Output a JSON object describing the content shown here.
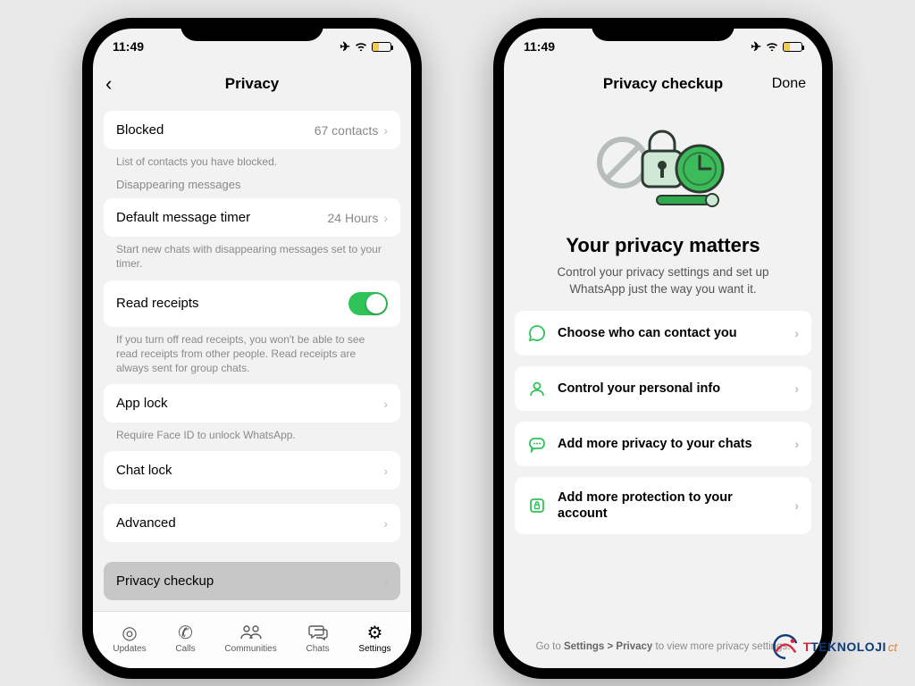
{
  "status": {
    "time": "11:49"
  },
  "phone1": {
    "header": {
      "title": "Privacy"
    },
    "blocked": {
      "label": "Blocked",
      "value": "67 contacts",
      "desc": "List of contacts you have blocked."
    },
    "disappearing_section": "Disappearing messages",
    "timer": {
      "label": "Default message timer",
      "value": "24 Hours",
      "desc": "Start new chats with disappearing messages set to your timer."
    },
    "receipts": {
      "label": "Read receipts",
      "desc": "If you turn off read receipts, you won't be able to see read receipts from other people. Read receipts are always sent for group chats."
    },
    "applock": {
      "label": "App lock",
      "desc": "Require Face ID to unlock WhatsApp."
    },
    "chatlock": {
      "label": "Chat lock"
    },
    "advanced": {
      "label": "Advanced"
    },
    "checkup": {
      "label": "Privacy checkup"
    },
    "tabs": {
      "updates": "Updates",
      "calls": "Calls",
      "communities": "Communities",
      "chats": "Chats",
      "settings": "Settings"
    }
  },
  "phone2": {
    "header": {
      "title": "Privacy checkup",
      "done": "Done"
    },
    "hero_title": "Your privacy matters",
    "hero_sub": "Control your privacy settings and set up WhatsApp just the way you want it.",
    "options": {
      "contact": "Choose who can contact you",
      "personal": "Control your personal info",
      "chats": "Add more privacy to your chats",
      "protection": "Add more protection to your account"
    },
    "footer": {
      "prefix": "Go to ",
      "link": "Settings > Privacy",
      "suffix": " to view more privacy settings."
    }
  },
  "watermark": {
    "part1": "TEKNOLOJI",
    "part2": "ct"
  }
}
